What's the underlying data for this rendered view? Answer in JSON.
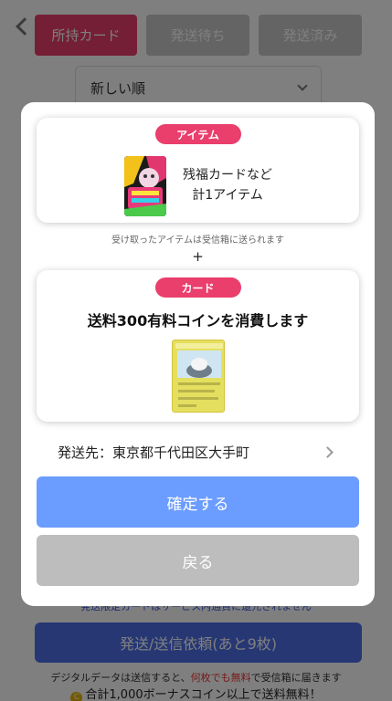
{
  "background": {
    "tabs": [
      {
        "label": "所持カード",
        "active": true
      },
      {
        "label": "発送待ち",
        "active": false
      },
      {
        "label": "発送済み",
        "active": false
      }
    ],
    "sort_label": "新しい順",
    "note": "発送限定カードはサービス内通貨に還元されません",
    "submit_label": "発送/送信依頼(あと9枚)",
    "info_pre": "デジタルデータは送信すると、",
    "info_red": "何枚でも無料",
    "info_post": "で受信箱に届きます",
    "coin_glyph": "C",
    "bonus_text": "合計1,000ボーナスコイン以上で送料無料！"
  },
  "modal": {
    "item_section": {
      "badge": "アイテム",
      "line1": "残福カードなど",
      "line2": "計1アイテム",
      "thumb_icon": "item-card-icon"
    },
    "received_note": "受け取ったアイテムは受信箱に送られます",
    "plus": "+",
    "card_section": {
      "badge": "カード",
      "consume_text": "送料300有料コインを消費します",
      "thumb_icon": "trading-card-icon"
    },
    "destination": "発送先：東京都千代田区大手町",
    "confirm_label": "確定する",
    "back_label": "戻る"
  },
  "colors": {
    "accent_pink": "#ea3e6c",
    "confirm_blue": "#6b9cff",
    "back_gray": "#bdbdbd",
    "submit_blue": "#4c6ee8"
  }
}
